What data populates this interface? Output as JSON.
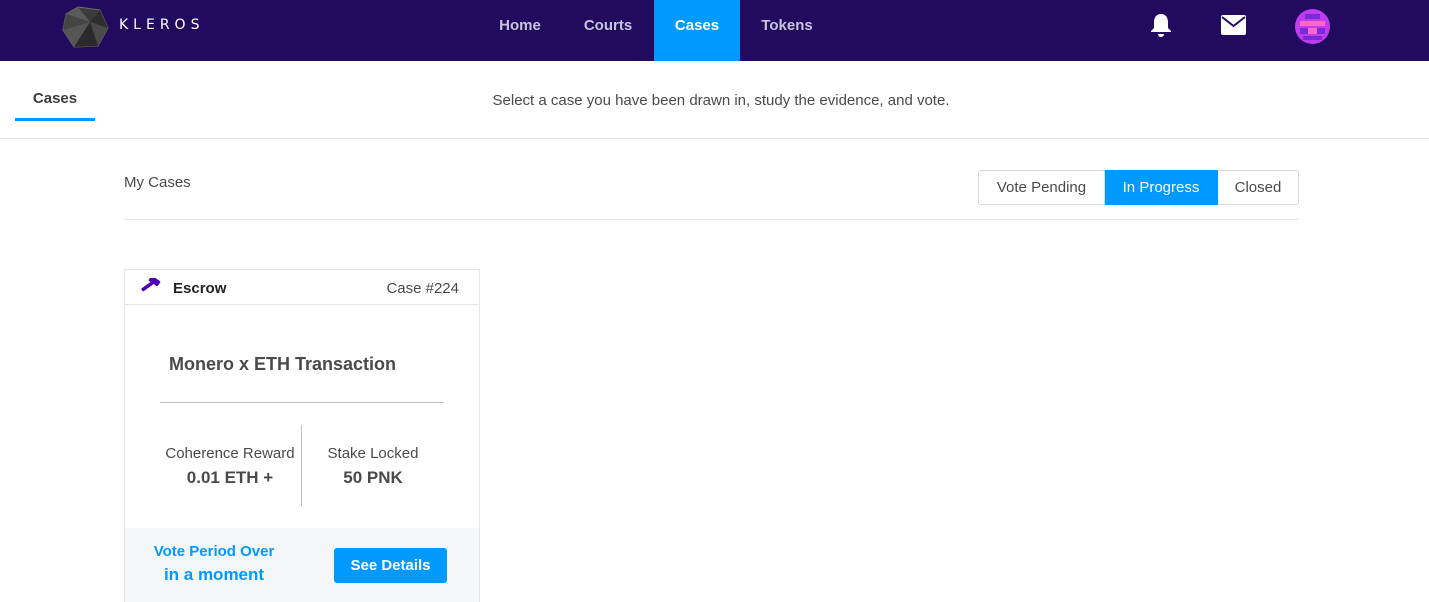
{
  "brand": {
    "name": "KLEROS"
  },
  "nav": {
    "items": [
      {
        "label": "Home"
      },
      {
        "label": "Courts"
      },
      {
        "label": "Cases"
      },
      {
        "label": "Tokens"
      }
    ]
  },
  "icons": {
    "logo": "kleros-logo-icon",
    "notifications": "bell-icon",
    "messages": "envelope-icon",
    "profile": "avatar-identicon",
    "court": "gavel-icon"
  },
  "colors": {
    "navbar": "#220a5f",
    "accent": "#009aff",
    "gavel": "#4d00b4"
  },
  "subheader": {
    "tab": "Cases",
    "description": "Select a case you have been drawn in, study the evidence, and vote."
  },
  "my_cases": {
    "title": "My Cases",
    "filters": [
      "Vote Pending",
      "In Progress",
      "Closed"
    ],
    "selected_filter": "In Progress"
  },
  "case_card": {
    "court": "Escrow",
    "case_number": "Case #224",
    "title": "Monero x ETH Transaction",
    "reward_label": "Coherence Reward",
    "reward_value": "0.01 ETH +",
    "stake_label": "Stake Locked",
    "stake_value": "50 PNK",
    "period_line1": "Vote Period Over",
    "period_line2": "in a moment",
    "button": "See Details"
  }
}
